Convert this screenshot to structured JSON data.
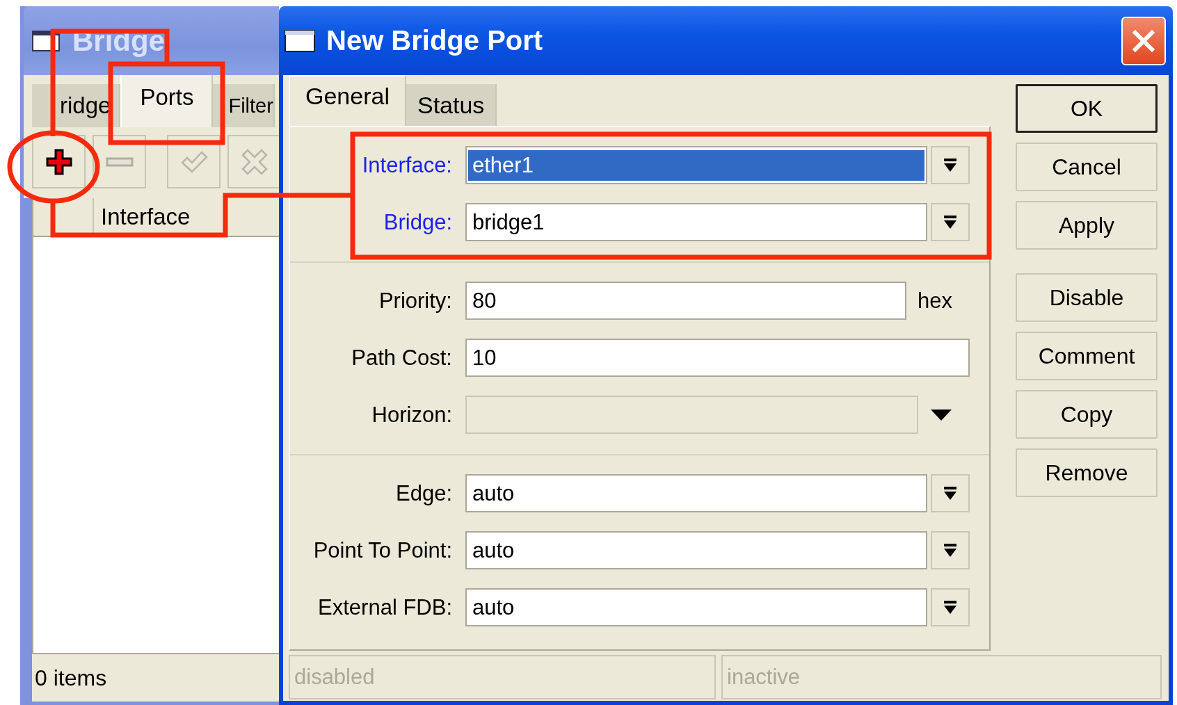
{
  "bridge_window": {
    "title": "Bridge",
    "tabs": [
      {
        "label": "ridge",
        "selected": false
      },
      {
        "label": "Ports",
        "selected": true
      },
      {
        "label": "Filter",
        "selected": false
      }
    ],
    "toolbar": [
      {
        "kind": "add",
        "disabled": false
      },
      {
        "kind": "remove",
        "disabled": true
      },
      {
        "kind": "enable",
        "disabled": true
      },
      {
        "kind": "disable",
        "disabled": true
      }
    ],
    "table": {
      "columns": [
        "Interface"
      ]
    },
    "status_bar": "0 items"
  },
  "dialog": {
    "title": "New Bridge Port",
    "tabs": [
      {
        "label": "General",
        "selected": true
      },
      {
        "label": "Status",
        "selected": false
      }
    ],
    "sections": [
      {
        "fields": [
          {
            "label": "Interface:",
            "value": "ether1",
            "kind": "dropdown",
            "link": true,
            "highlighted": true
          },
          {
            "label": "Bridge:",
            "value": "bridge1",
            "kind": "dropdown",
            "link": true,
            "highlighted": false
          }
        ]
      },
      {
        "fields": [
          {
            "label": "Priority:",
            "value": "80",
            "kind": "text",
            "unit": "hex"
          },
          {
            "label": "Path Cost:",
            "value": "10",
            "kind": "text"
          },
          {
            "label": "Horizon:",
            "kind": "combo",
            "disabled": true
          }
        ]
      },
      {
        "fields": [
          {
            "label": "Edge:",
            "value": "auto",
            "kind": "dropdown",
            "link": false,
            "highlighted": false
          },
          {
            "label": "Point To Point:",
            "value": "auto",
            "kind": "dropdown",
            "link": false,
            "highlighted": false
          },
          {
            "label": "External FDB:",
            "value": "auto",
            "kind": "dropdown",
            "link": false,
            "highlighted": false
          }
        ]
      }
    ],
    "button_groups": [
      {
        "buttons": [
          {
            "label": "OK",
            "default": true
          },
          {
            "label": "Cancel",
            "default": false
          },
          {
            "label": "Apply",
            "default": false
          }
        ]
      },
      {
        "buttons": [
          {
            "label": "Disable",
            "default": false
          },
          {
            "label": "Comment",
            "default": false
          },
          {
            "label": "Copy",
            "default": false
          },
          {
            "label": "Remove",
            "default": false
          }
        ]
      }
    ],
    "status_bar": [
      "disabled",
      "inactive"
    ]
  }
}
